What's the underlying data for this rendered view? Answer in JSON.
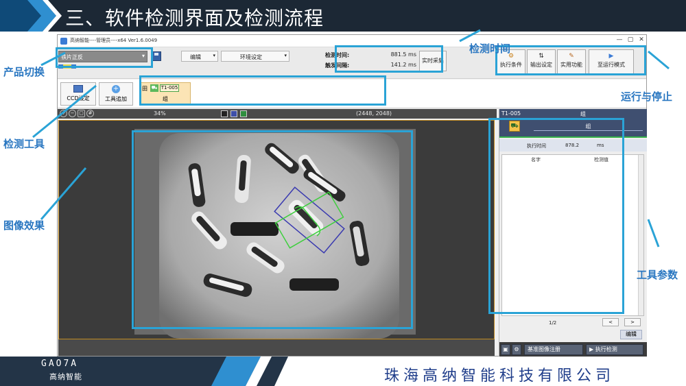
{
  "slide": {
    "title": "三、软件检测界面及检测流程",
    "company": "珠海高纳智能科技有限公司",
    "logo_text": "GAO7A",
    "logo_cn": "高纳智能"
  },
  "window": {
    "title": "高纳智能----管理员----x64 Ver1.6.0049",
    "controls": [
      "—",
      "▢",
      "✕"
    ]
  },
  "toolbar": {
    "product_select": "铁片正反",
    "edit_label": "编辑",
    "env_label": "环境设定",
    "detect_time_label": "检测时间:",
    "detect_time_value": "881.5 ms",
    "trigger_interval_label": "触发间隔:",
    "trigger_interval_value": "141.2 ms",
    "realtime_capture": "实时采集",
    "exec_condition": "执行条件",
    "output_setting": "输出设定",
    "utility": "实用功能",
    "to_run_mode": "至运行模式"
  },
  "tools": {
    "ccd_setting": "CCD设定",
    "add_tool": "工具追加",
    "flow_expand": "田",
    "flow_tool_id": "T1-005",
    "flow_group": "组"
  },
  "image_bar": {
    "zoom": "34%",
    "resolution": "(2448, 2048)"
  },
  "right_panel": {
    "tool_id": "T1-005",
    "header_group": "组",
    "group_label": "组",
    "exec_time_label": "执行时间",
    "exec_time_value": "878.2",
    "exec_time_unit": "ms",
    "col_name": "名字",
    "col_value": "检测值",
    "page": "1/2",
    "prev": "<",
    "next": ">",
    "edit": "编辑",
    "register_ref": "基准图像注册",
    "run_detect": "执行检测"
  },
  "annotations": {
    "product_switch": "产品切换",
    "detect_tool": "检测工具",
    "image_effect": "图像效果",
    "detect_time": "检测时间",
    "run_stop": "运行与停止",
    "tool_params": "工具参数"
  },
  "colors": {
    "header_bg": "#1c2835",
    "annotation_blue": "#2a77c1",
    "box_blue": "#2aa3d6",
    "company_blue": "#1f3d8a"
  }
}
